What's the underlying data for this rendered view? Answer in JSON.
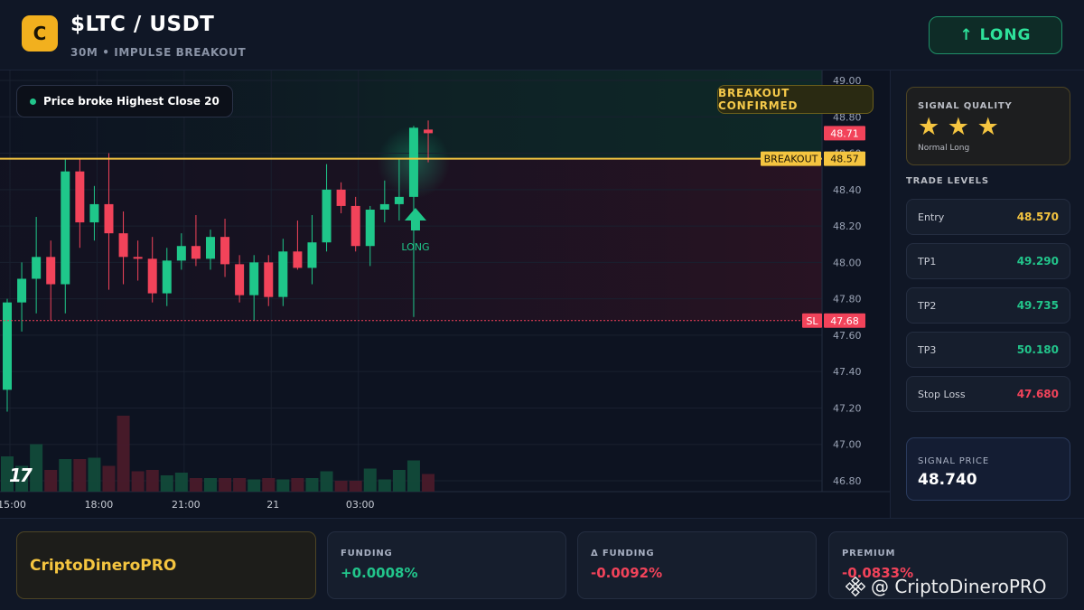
{
  "header": {
    "coin_letter": "C",
    "pair": "$LTC / USDT",
    "subtitle": "30M • IMPULSE BREAKOUT",
    "signal_button": "↑ LONG"
  },
  "chart_overlay": {
    "condition_text": "Price broke Highest Close 20",
    "confirm_badge": "BREAKOUT CONFIRMED",
    "long_marker_label": "LONG",
    "breakout_tag": "BREAKOUT",
    "sl_tag": "SL",
    "tv_logo": "17"
  },
  "colors": {
    "up": "#1fc78a",
    "down": "#f2435a",
    "breakout_line": "#f5c540",
    "sl_line": "#f2435a",
    "accent_gold": "#f5c540",
    "positive": "#22c58b",
    "negative": "#f2435a"
  },
  "chart_data": {
    "type": "candlestick",
    "title": "",
    "ylim": [
      46.75,
      49.05
    ],
    "y_ticks": [
      "49.00",
      "48.80",
      "48.60",
      "48.40",
      "48.20",
      "48.00",
      "47.80",
      "47.60",
      "47.40",
      "47.20",
      "47.00",
      "46.80"
    ],
    "x_tick_labels": [
      "15:00",
      "18:00",
      "21:00",
      "21",
      "03:00"
    ],
    "x_tick_index": [
      0,
      6,
      12,
      18,
      24
    ],
    "candles": [
      {
        "o": 47.3,
        "h": 47.8,
        "l": 47.18,
        "c": 47.78
      },
      {
        "o": 47.78,
        "h": 48.0,
        "l": 47.62,
        "c": 47.91
      },
      {
        "o": 47.91,
        "h": 48.25,
        "l": 47.72,
        "c": 48.03
      },
      {
        "o": 48.03,
        "h": 48.12,
        "l": 47.68,
        "c": 47.88
      },
      {
        "o": 47.88,
        "h": 48.57,
        "l": 47.72,
        "c": 48.5
      },
      {
        "o": 48.5,
        "h": 48.57,
        "l": 48.08,
        "c": 48.22
      },
      {
        "o": 48.22,
        "h": 48.42,
        "l": 48.12,
        "c": 48.32
      },
      {
        "o": 48.32,
        "h": 48.6,
        "l": 47.85,
        "c": 48.16
      },
      {
        "o": 48.16,
        "h": 48.28,
        "l": 47.88,
        "c": 48.03
      },
      {
        "o": 48.03,
        "h": 48.12,
        "l": 47.9,
        "c": 48.02
      },
      {
        "o": 48.02,
        "h": 48.14,
        "l": 47.78,
        "c": 47.83
      },
      {
        "o": 47.83,
        "h": 48.08,
        "l": 47.76,
        "c": 48.01
      },
      {
        "o": 48.01,
        "h": 48.16,
        "l": 47.96,
        "c": 48.09
      },
      {
        "o": 48.09,
        "h": 48.26,
        "l": 47.98,
        "c": 48.02
      },
      {
        "o": 48.02,
        "h": 48.18,
        "l": 47.96,
        "c": 48.14
      },
      {
        "o": 48.14,
        "h": 48.24,
        "l": 47.92,
        "c": 47.99
      },
      {
        "o": 47.99,
        "h": 48.04,
        "l": 47.78,
        "c": 47.82
      },
      {
        "o": 47.82,
        "h": 48.04,
        "l": 47.68,
        "c": 48.0
      },
      {
        "o": 48.0,
        "h": 48.04,
        "l": 47.76,
        "c": 47.81
      },
      {
        "o": 47.81,
        "h": 48.13,
        "l": 47.76,
        "c": 48.06
      },
      {
        "o": 48.06,
        "h": 48.23,
        "l": 47.96,
        "c": 47.97
      },
      {
        "o": 47.97,
        "h": 48.26,
        "l": 47.88,
        "c": 48.11
      },
      {
        "o": 48.11,
        "h": 48.54,
        "l": 48.06,
        "c": 48.4
      },
      {
        "o": 48.4,
        "h": 48.44,
        "l": 48.27,
        "c": 48.31
      },
      {
        "o": 48.31,
        "h": 48.36,
        "l": 48.06,
        "c": 48.09
      },
      {
        "o": 48.09,
        "h": 48.31,
        "l": 47.98,
        "c": 48.29
      },
      {
        "o": 48.29,
        "h": 48.45,
        "l": 48.22,
        "c": 48.32
      },
      {
        "o": 48.32,
        "h": 48.57,
        "l": 48.23,
        "c": 48.36
      },
      {
        "o": 48.36,
        "h": 48.75,
        "l": 47.7,
        "c": 48.74
      },
      {
        "o": 48.73,
        "h": 48.78,
        "l": 48.55,
        "c": 48.71
      }
    ],
    "volumes": [
      52,
      38,
      70,
      32,
      48,
      48,
      50,
      38,
      112,
      30,
      32,
      24,
      28,
      20,
      20,
      20,
      20,
      18,
      20,
      18,
      20,
      20,
      30,
      16,
      16,
      34,
      18,
      32,
      46,
      26
    ],
    "levels": {
      "breakout": 48.57,
      "stop_loss": 47.68,
      "last_price": 48.71
    },
    "price_tags": {
      "last": "48.71",
      "breakout": "48.57",
      "sl": "47.68"
    },
    "breakout_candle_index": 28
  },
  "right_panel": {
    "quality_title": "SIGNAL QUALITY",
    "stars": "★ ★ ★",
    "quality_sub": "Normal Long",
    "levels_title": "TRADE LEVELS",
    "levels": [
      {
        "label": "Entry",
        "value": "48.570",
        "color": "#f5c540"
      },
      {
        "label": "TP1",
        "value": "49.290",
        "color": "#22c58b"
      },
      {
        "label": "TP2",
        "value": "49.735",
        "color": "#22c58b"
      },
      {
        "label": "TP3",
        "value": "50.180",
        "color": "#22c58b"
      },
      {
        "label": "Stop Loss",
        "value": "47.680",
        "color": "#f2435a"
      }
    ],
    "signal_price_title": "SIGNAL PRICE",
    "signal_price_value": "48.740"
  },
  "bottom": {
    "brand": "CriptoDineroPRO",
    "stats": [
      {
        "label": "FUNDING",
        "value": "+0.0008%",
        "color": "#22c58b"
      },
      {
        "label": "Δ FUNDING",
        "value": "-0.0092%",
        "color": "#f2435a"
      },
      {
        "label": "PREMIUM",
        "value": "-0.0833%",
        "color": "#f2435a"
      }
    ],
    "watermark": "@ CriptoDineroPRO"
  }
}
